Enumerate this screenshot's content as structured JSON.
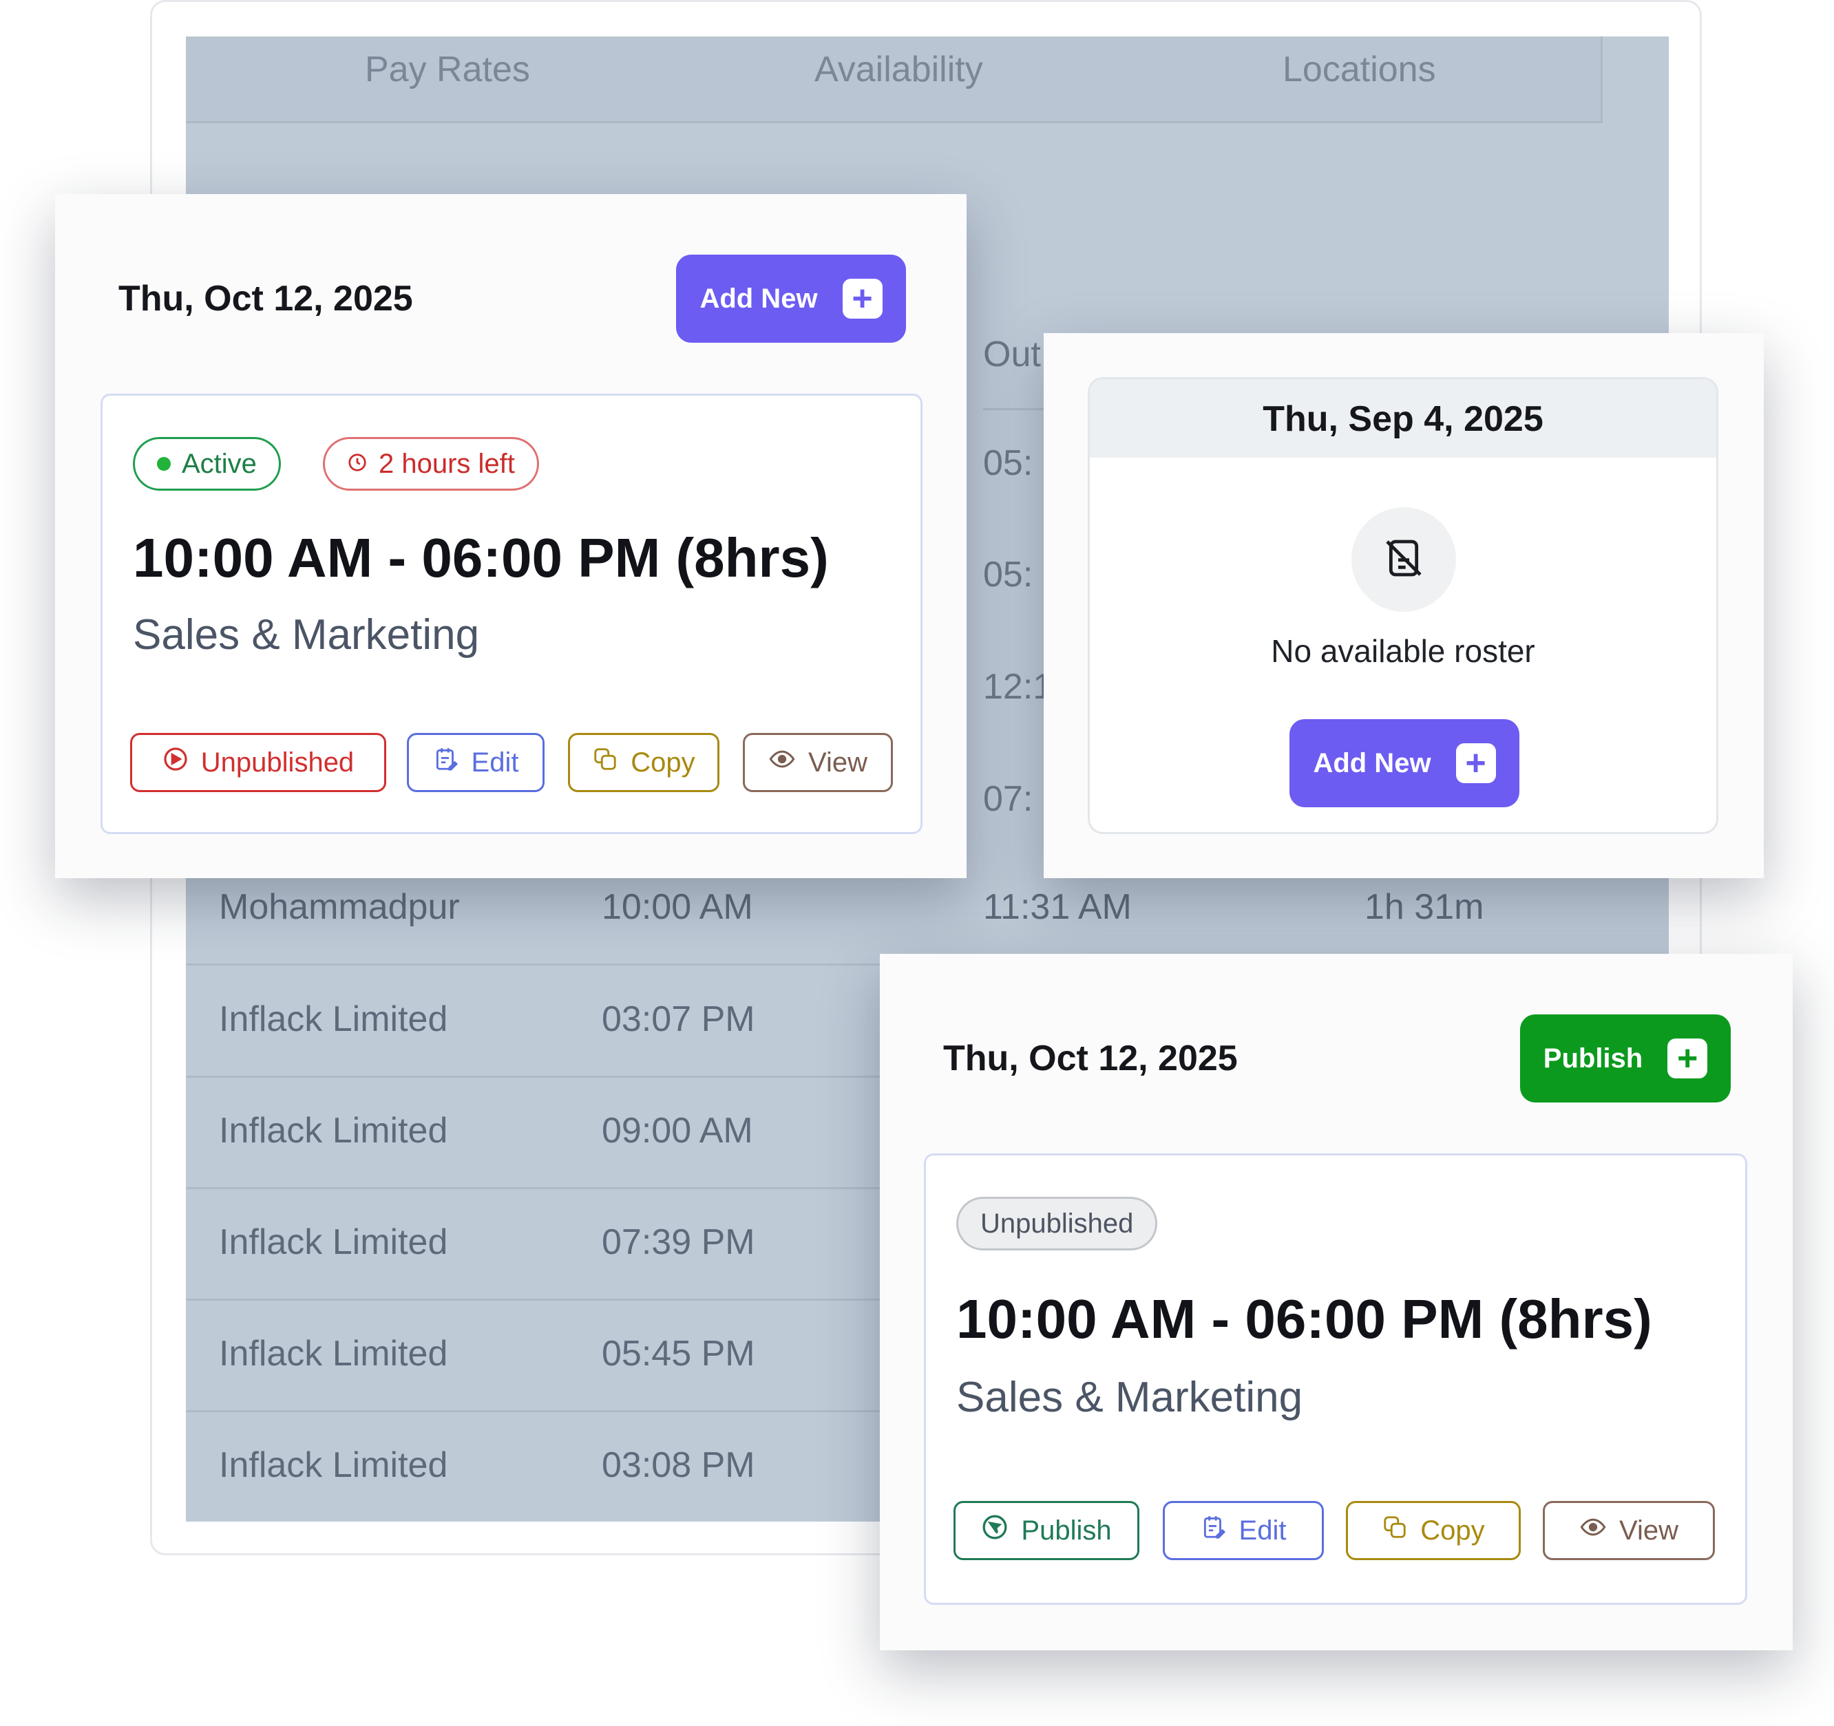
{
  "background": {
    "tabs": [
      "Pay Rates",
      "Availability",
      "Locations"
    ],
    "peek_header": "Out",
    "peek_times": [
      "05:",
      "05:",
      "12:1",
      "07:"
    ],
    "rows": [
      {
        "location": "Mohammadpur",
        "in": "10:00 AM",
        "out": "11:31 AM",
        "duration": "1h 31m"
      },
      {
        "location": "Inflack Limited",
        "in": "03:07 PM"
      },
      {
        "location": "Inflack Limited",
        "in": "09:00 AM"
      },
      {
        "location": "Inflack Limited",
        "in": "07:39 PM"
      },
      {
        "location": "Inflack Limited",
        "in": "05:45 PM"
      },
      {
        "location": "Inflack Limited",
        "in": "03:08 PM"
      }
    ]
  },
  "card_active": {
    "date": "Thu, Oct 12, 2025",
    "add_label": "Add New",
    "status": "Active",
    "remaining": "2 hours left",
    "time_range": "10:00 AM - 06:00 PM (8hrs)",
    "department": "Sales & Marketing",
    "actions": {
      "unpublished": "Unpublished",
      "edit": "Edit",
      "copy": "Copy",
      "view": "View"
    }
  },
  "card_empty": {
    "date": "Thu, Sep 4, 2025",
    "message": "No available roster",
    "add_label": "Add New"
  },
  "card_unpublished": {
    "date": "Thu, Oct 12, 2025",
    "publish_label": "Publish",
    "status": "Unpublished",
    "time_range": "10:00 AM - 06:00 PM (8hrs)",
    "department": "Sales & Marketing",
    "actions": {
      "publish": "Publish",
      "edit": "Edit",
      "copy": "Copy",
      "view": "View"
    }
  },
  "colors": {
    "accent_purple": "#6c5cf2",
    "publish_green": "#0b9a1e",
    "active_green": "#22b33a",
    "alert_red": "#d12f2f",
    "edit_blue": "#5a6ee0",
    "copy_gold": "#a88a10",
    "view_brown": "#8a6a5c",
    "publish_teal": "#1f7a56"
  }
}
